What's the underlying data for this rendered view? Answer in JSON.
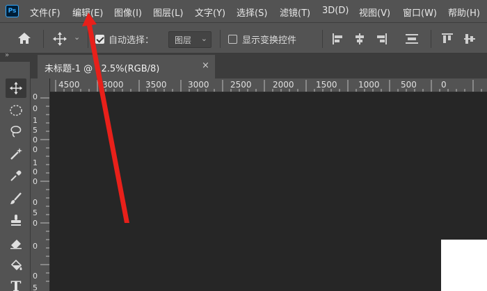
{
  "app": {
    "logo_text": "Ps"
  },
  "menu": {
    "items": [
      {
        "label": "文件(F)"
      },
      {
        "label": "编辑(E)"
      },
      {
        "label": "图像(I)"
      },
      {
        "label": "图层(L)"
      },
      {
        "label": "文字(Y)"
      },
      {
        "label": "选择(S)"
      },
      {
        "label": "滤镜(T)"
      },
      {
        "label": "3D(D)"
      },
      {
        "label": "视图(V)"
      },
      {
        "label": "窗口(W)"
      },
      {
        "label": "帮助(H)"
      }
    ]
  },
  "options_bar": {
    "auto_select_label": "自动选择：",
    "auto_select_checked": true,
    "auto_select_target": "图层",
    "show_transform_label": "显示变换控件",
    "show_transform_checked": false
  },
  "panel_collapse": {
    "glyph": "»"
  },
  "document": {
    "tab_title": "未标题-1 @ 12.5%(RGB/8)",
    "close_glyph": "×"
  },
  "rulers": {
    "horizontal_labels": [
      "4500",
      "3000",
      "3500",
      "3000",
      "2500",
      "2000",
      "1500",
      "1000",
      "500",
      "0"
    ],
    "vertical_labels": [
      "0",
      "0",
      "1",
      "5",
      "0",
      "0",
      "1",
      "0",
      "0",
      "0",
      "5",
      "0",
      "0",
      "0",
      "5"
    ]
  },
  "toolbar": {
    "tools": [
      {
        "icon": "move-icon",
        "active": true
      },
      {
        "icon": "marquee-icon"
      },
      {
        "icon": "lasso-icon"
      },
      {
        "icon": "magic-wand-icon"
      },
      {
        "icon": "eyedropper-icon"
      },
      {
        "icon": "brush-icon"
      },
      {
        "icon": "stamp-icon"
      },
      {
        "icon": "eraser-icon"
      },
      {
        "icon": "paint-bucket-icon"
      },
      {
        "icon": "type-icon",
        "glyph": "T"
      }
    ]
  },
  "colors": {
    "ui_panel": "#535353",
    "canvas_bg": "#262626",
    "annotation_arrow": "#e8201a",
    "ps_blue": "#31a8ff"
  }
}
